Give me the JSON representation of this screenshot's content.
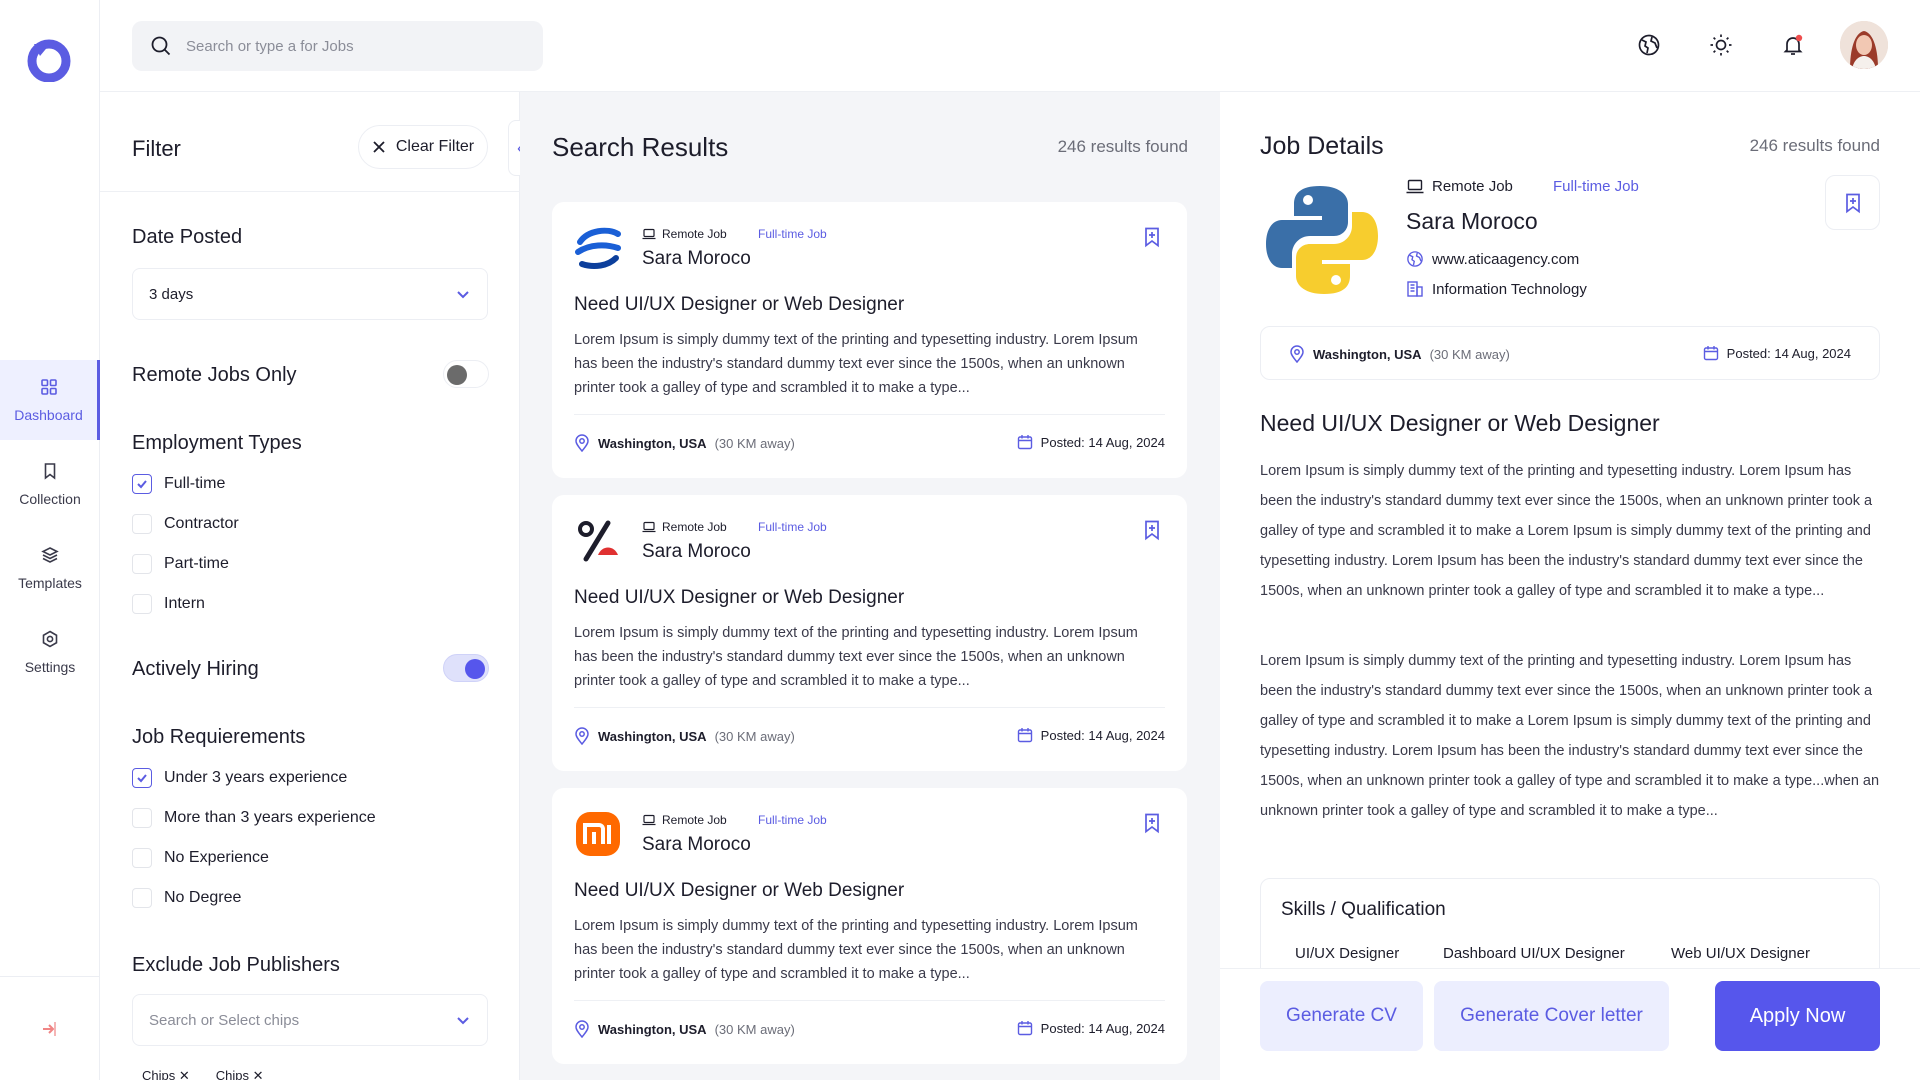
{
  "search": {
    "placeholder": "Search or type a for Jobs"
  },
  "colors": {
    "accent": "#5b5ce2",
    "primary_button": "#5656ec",
    "panel_bg": "#f4f5f8"
  },
  "sidebar": {
    "items": [
      {
        "label": "Dashboard",
        "icon": "grid-icon",
        "active": true
      },
      {
        "label": "Collection",
        "icon": "bookmark-icon",
        "active": false
      },
      {
        "label": "Templates",
        "icon": "layers-icon",
        "active": false
      },
      {
        "label": "Settings",
        "icon": "settings-icon",
        "active": false
      }
    ],
    "bottom_icon": "logout-icon"
  },
  "topbar": {
    "icons": [
      "globe-icon",
      "sun-icon",
      "bell-icon"
    ],
    "has_notification": true
  },
  "filter": {
    "title": "Filter",
    "clear_label": "Clear Filter",
    "collapse_glyph": "‹",
    "date_posted": {
      "title": "Date Posted",
      "value": "3 days"
    },
    "remote_only": {
      "title": "Remote Jobs Only",
      "on": false
    },
    "employment_types": {
      "title": "Employment Types",
      "options": [
        {
          "label": "Full-time",
          "checked": true
        },
        {
          "label": "Contractor",
          "checked": false
        },
        {
          "label": "Part-time",
          "checked": false
        },
        {
          "label": "Intern",
          "checked": false
        }
      ]
    },
    "actively_hiring": {
      "title": "Actively Hiring",
      "on": true
    },
    "requirements": {
      "title": "Job Requierements",
      "options": [
        {
          "label": "Under 3 years experience",
          "checked": true
        },
        {
          "label": "More than 3 years experience",
          "checked": false
        },
        {
          "label": "No Experience",
          "checked": false
        },
        {
          "label": "No Degree",
          "checked": false
        }
      ]
    },
    "exclude_publishers": {
      "title": "Exclude Job Publishers",
      "placeholder": "Search or Select chips",
      "chips": [
        "Chips",
        "Chips"
      ]
    }
  },
  "results": {
    "title": "Search Results",
    "count": "246 results found",
    "cards": [
      {
        "logo": "wave-logo",
        "remote": "Remote Job",
        "type": "Full-time Job",
        "company": "Sara Moroco",
        "title": "Need UI/UX Designer or Web Designer",
        "desc": "Lorem Ipsum is simply dummy text of the printing and typesetting industry. Lorem Ipsum has been the industry's standard dummy text ever since the 1500s, when an unknown printer took a galley of type and scrambled it to make a type...",
        "location": "Washington, USA",
        "distance": "(30 KM away)",
        "posted": "Posted: 14 Aug, 2024"
      },
      {
        "logo": "percent-logo",
        "remote": "Remote Job",
        "type": "Full-time Job",
        "company": "Sara Moroco",
        "title": "Need UI/UX Designer or Web Designer",
        "desc": "Lorem Ipsum is simply dummy text of the printing and typesetting industry. Lorem Ipsum has been the industry's standard dummy text ever since the 1500s, when an unknown printer took a galley of type and scrambled it to make a type...",
        "location": "Washington, USA",
        "distance": "(30 KM away)",
        "posted": "Posted: 14 Aug, 2024"
      },
      {
        "logo": "mi-logo",
        "remote": "Remote Job",
        "type": "Full-time Job",
        "company": "Sara Moroco",
        "title": "Need UI/UX Designer or Web Designer",
        "desc": "Lorem Ipsum is simply dummy text of the printing and typesetting industry. Lorem Ipsum has been the industry's standard dummy text ever since the 1500s, when an unknown printer took a galley of type and scrambled it to make a type...",
        "location": "Washington, USA",
        "distance": "(30 KM away)",
        "posted": "Posted: 14 Aug, 2024"
      }
    ]
  },
  "details": {
    "title": "Job Details",
    "count": "246 results found",
    "logo": "python-logo",
    "remote": "Remote Job",
    "type": "Full-time Job",
    "company": "Sara Moroco",
    "website": "www.aticaagency.com",
    "industry": "Information Technology",
    "location": "Washington, USA",
    "distance": "(30 KM away)",
    "posted": "Posted: 14 Aug, 2024",
    "job_title": "Need UI/UX Designer or Web Designer",
    "para1": "Lorem Ipsum is simply dummy text of the printing and typesetting industry. Lorem Ipsum has been the industry's standard dummy text ever since the 1500s, when an unknown printer took a galley of type and scrambled it to make a Lorem Ipsum is simply dummy text of the printing and typesetting industry. Lorem Ipsum has been the industry's standard dummy text ever since the 1500s, when an unknown printer took a galley of type and scrambled it to make a type...",
    "para2": "Lorem Ipsum is simply dummy text of the printing and typesetting industry. Lorem Ipsum has been the industry's standard dummy text ever since the 1500s, when an unknown printer took a galley of type and scrambled it to make a Lorem Ipsum is simply dummy text of the printing and typesetting industry. Lorem Ipsum has been the industry's standard dummy text ever since the 1500s, when an unknown printer took a galley of type and scrambled it to make a type...when an unknown printer took a galley of type and scrambled it to make a type...",
    "skills_title": "Skills / Qualification",
    "skills": [
      "UI/UX Designer",
      "Dashboard UI/UX Designer",
      "Web UI/UX Designer"
    ],
    "buttons": {
      "cv": "Generate CV",
      "cover": "Generate Cover letter",
      "apply": "Apply Now"
    }
  }
}
